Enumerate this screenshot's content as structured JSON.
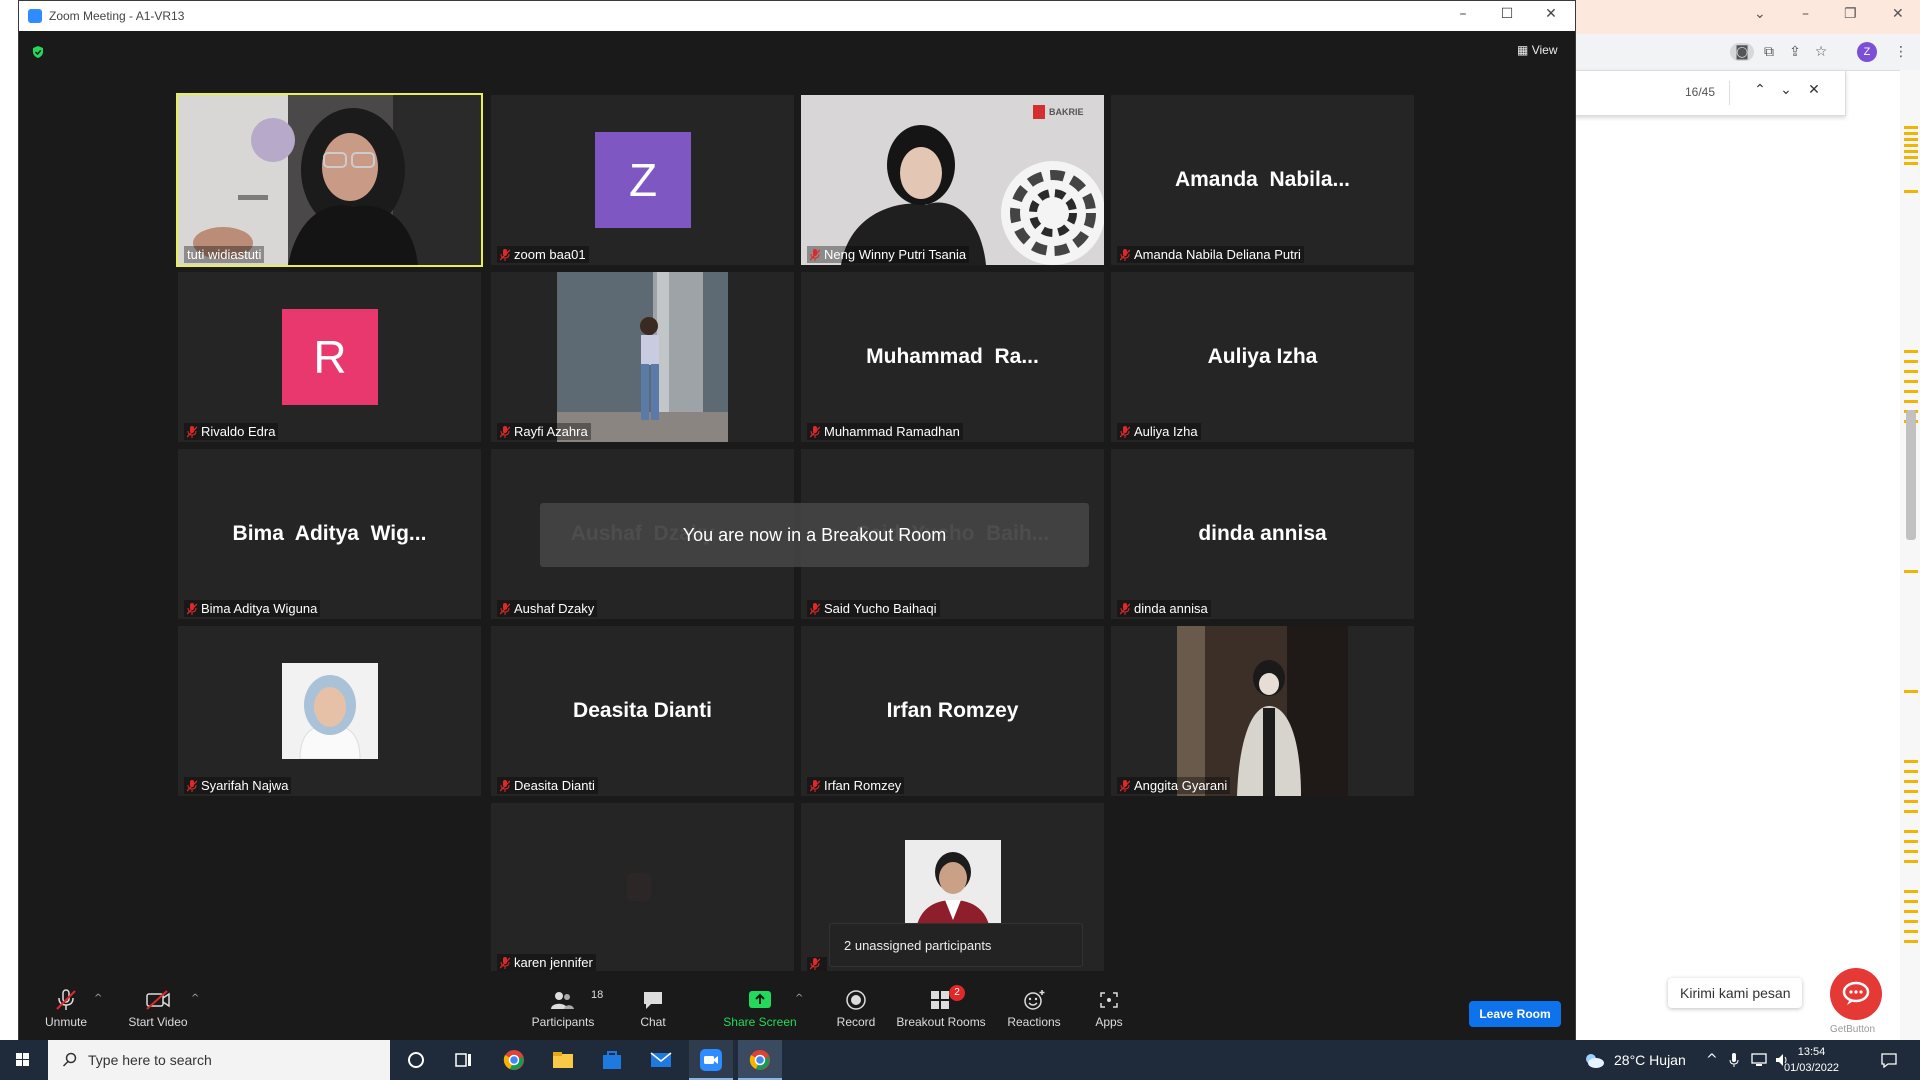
{
  "window": {
    "title": "Zoom Meeting - A1-VR13"
  },
  "header": {
    "view_label": "View"
  },
  "find_bar": {
    "count": "16/45"
  },
  "profile": {
    "initial": "Z"
  },
  "participants": [
    {
      "name": "tuti widiastuti",
      "kind": "video",
      "active": true
    },
    {
      "name": "zoom baa01",
      "kind": "avatar",
      "initial": "Z",
      "avatar_color": "#7e57c2"
    },
    {
      "name": "Neng Winny Putri Tsania",
      "kind": "video",
      "logo_text": "BAKRIE"
    },
    {
      "name": "Amanda Nabila Deliana Putri",
      "kind": "name",
      "display": "Amanda  Nabila..."
    },
    {
      "name": "Rivaldo Edra",
      "kind": "avatar",
      "initial": "R",
      "avatar_color": "#e8386d"
    },
    {
      "name": "Rayfi Azahra",
      "kind": "photo"
    },
    {
      "name": "Muhammad Ramadhan",
      "kind": "name",
      "display": "Muhammad  Ra..."
    },
    {
      "name": "Auliya Izha",
      "kind": "name",
      "display": "Auliya Izha"
    },
    {
      "name": "Bima Aditya Wiguna",
      "kind": "name",
      "display": "Bima  Aditya  Wig..."
    },
    {
      "name": "Aushaf Dzaky",
      "kind": "name",
      "display": "Aushaf  Dzaky"
    },
    {
      "name": "Said Yucho Baihaqi",
      "kind": "name",
      "display": "Said  Yucho  Baih..."
    },
    {
      "name": "dinda annisa",
      "kind": "name",
      "display": "dinda annisa"
    },
    {
      "name": "Syarifah Najwa",
      "kind": "photo"
    },
    {
      "name": "Deasita Dianti",
      "kind": "name",
      "display": "Deasita Dianti"
    },
    {
      "name": "Irfan Romzey",
      "kind": "name",
      "display": "Irfan Romzey"
    },
    {
      "name": "Anggita Gyarani",
      "kind": "photo"
    },
    {
      "name": "karen jennifer",
      "kind": "video"
    },
    {
      "name": "",
      "kind": "photo"
    }
  ],
  "notifications": {
    "breakout": "You are now in a Breakout Room",
    "unassigned": "2 unassigned participants"
  },
  "toolbar": {
    "unmute": "Unmute",
    "start_video": "Start Video",
    "participants": "Participants",
    "participants_count": "18",
    "chat": "Chat",
    "share_screen": "Share Screen",
    "record": "Record",
    "breakout_rooms": "Breakout Rooms",
    "breakout_badge": "2",
    "reactions": "Reactions",
    "apps": "Apps",
    "leave_room": "Leave Room"
  },
  "chat_widget": {
    "label": "Kirimi kami pesan",
    "brand": "GetButton"
  },
  "taskbar": {
    "search_placeholder": "Type here to search",
    "weather": "28°C  Hujan",
    "time": "13:54",
    "date": "01/03/2022"
  },
  "colors": {
    "active_speaker": "#e8ef53",
    "muted_icon": "#e02828",
    "share_screen": "#23d959",
    "leave_button": "#0e72ed"
  }
}
